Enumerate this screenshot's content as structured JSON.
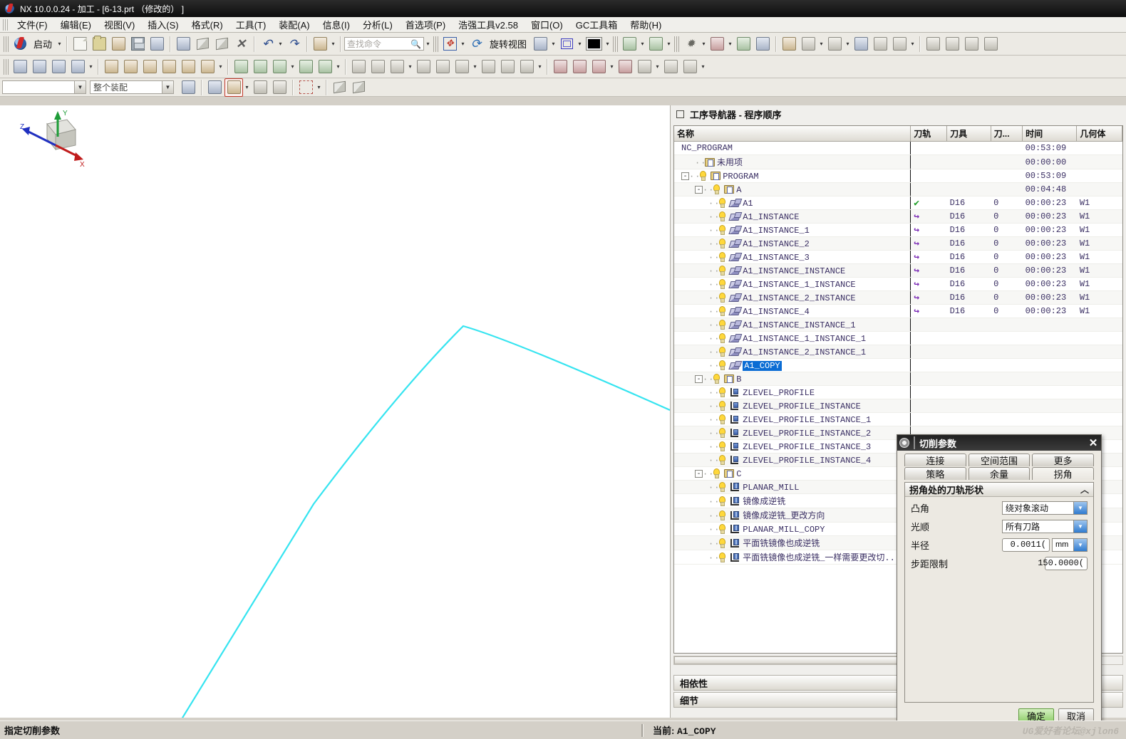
{
  "window": {
    "title": "NX 10.0.0.24 - 加工 - [6-13.prt  （修改的）  ]",
    "app_icon": "nx-logo-icon"
  },
  "menubar": {
    "items": [
      {
        "label": "文件(F)"
      },
      {
        "label": "编辑(E)"
      },
      {
        "label": "视图(V)"
      },
      {
        "label": "插入(S)"
      },
      {
        "label": "格式(R)"
      },
      {
        "label": "工具(T)"
      },
      {
        "label": "装配(A)"
      },
      {
        "label": "信息(I)"
      },
      {
        "label": "分析(L)"
      },
      {
        "label": "首选项(P)"
      },
      {
        "label": "浩强工具v2.58"
      },
      {
        "label": "窗口(O)"
      },
      {
        "label": "GC工具箱"
      },
      {
        "label": "帮助(H)"
      }
    ]
  },
  "toolbar": {
    "start_label": "启动",
    "search_placeholder": "查找命令",
    "rotate_view_label": "旋转视图",
    "assembly_scope": "整个装配",
    "assembly_filter_placeholder": ""
  },
  "navigator": {
    "title": "工序导航器 - 程序顺序",
    "columns": [
      "名称",
      "刀轨",
      "刀具",
      "刀...",
      "时间",
      "几何体"
    ],
    "rows": [
      {
        "indent": 0,
        "twist": "",
        "icon": "none",
        "bulb": false,
        "name": "NC_PROGRAM",
        "track": "",
        "tool": "",
        "toolnum": "",
        "time": "00:53:09",
        "geom": ""
      },
      {
        "indent": 1,
        "twist": "",
        "icon": "folder",
        "bulb": false,
        "name": "未用项",
        "track": "",
        "tool": "",
        "toolnum": "",
        "time": "00:00:00",
        "geom": ""
      },
      {
        "indent": 0,
        "twist": "-",
        "icon": "folder",
        "bulb": true,
        "name": "PROGRAM",
        "track": "",
        "tool": "",
        "toolnum": "",
        "time": "00:53:09",
        "geom": ""
      },
      {
        "indent": 1,
        "twist": "-",
        "icon": "folder",
        "bulb": true,
        "name": "A",
        "track": "",
        "tool": "",
        "toolnum": "",
        "time": "00:04:48",
        "geom": ""
      },
      {
        "indent": 2,
        "twist": "",
        "icon": "mill3d",
        "bulb": true,
        "name": "A1",
        "track": "check",
        "tool": "D16",
        "toolnum": "0",
        "time": "00:00:23",
        "geom": "W1"
      },
      {
        "indent": 2,
        "twist": "",
        "icon": "mill3d",
        "bulb": true,
        "name": "A1_INSTANCE",
        "track": "arrow",
        "tool": "D16",
        "toolnum": "0",
        "time": "00:00:23",
        "geom": "W1"
      },
      {
        "indent": 2,
        "twist": "",
        "icon": "mill3d",
        "bulb": true,
        "name": "A1_INSTANCE_1",
        "track": "arrow",
        "tool": "D16",
        "toolnum": "0",
        "time": "00:00:23",
        "geom": "W1"
      },
      {
        "indent": 2,
        "twist": "",
        "icon": "mill3d",
        "bulb": true,
        "name": "A1_INSTANCE_2",
        "track": "arrow",
        "tool": "D16",
        "toolnum": "0",
        "time": "00:00:23",
        "geom": "W1"
      },
      {
        "indent": 2,
        "twist": "",
        "icon": "mill3d",
        "bulb": true,
        "name": "A1_INSTANCE_3",
        "track": "arrow",
        "tool": "D16",
        "toolnum": "0",
        "time": "00:00:23",
        "geom": "W1"
      },
      {
        "indent": 2,
        "twist": "",
        "icon": "mill3d",
        "bulb": true,
        "name": "A1_INSTANCE_INSTANCE",
        "track": "arrow",
        "tool": "D16",
        "toolnum": "0",
        "time": "00:00:23",
        "geom": "W1"
      },
      {
        "indent": 2,
        "twist": "",
        "icon": "mill3d",
        "bulb": true,
        "name": "A1_INSTANCE_1_INSTANCE",
        "track": "arrow",
        "tool": "D16",
        "toolnum": "0",
        "time": "00:00:23",
        "geom": "W1"
      },
      {
        "indent": 2,
        "twist": "",
        "icon": "mill3d",
        "bulb": true,
        "name": "A1_INSTANCE_2_INSTANCE",
        "track": "arrow",
        "tool": "D16",
        "toolnum": "0",
        "time": "00:00:23",
        "geom": "W1"
      },
      {
        "indent": 2,
        "twist": "",
        "icon": "mill3d",
        "bulb": true,
        "name": "A1_INSTANCE_4",
        "track": "arrow",
        "tool": "D16",
        "toolnum": "0",
        "time": "00:00:23",
        "geom": "W1"
      },
      {
        "indent": 2,
        "twist": "",
        "icon": "mill3d",
        "bulb": true,
        "name": "A1_INSTANCE_INSTANCE_1",
        "track": "",
        "tool": "",
        "toolnum": "",
        "time": "",
        "geom": ""
      },
      {
        "indent": 2,
        "twist": "",
        "icon": "mill3d",
        "bulb": true,
        "name": "A1_INSTANCE_1_INSTANCE_1",
        "track": "",
        "tool": "",
        "toolnum": "",
        "time": "",
        "geom": ""
      },
      {
        "indent": 2,
        "twist": "",
        "icon": "mill3d",
        "bulb": true,
        "name": "A1_INSTANCE_2_INSTANCE_1",
        "track": "",
        "tool": "",
        "toolnum": "",
        "time": "",
        "geom": ""
      },
      {
        "indent": 2,
        "twist": "",
        "icon": "mill3d",
        "bulb": true,
        "name": "A1_COPY",
        "track": "",
        "tool": "",
        "toolnum": "",
        "time": "",
        "geom": "",
        "selected": true
      },
      {
        "indent": 1,
        "twist": "-",
        "icon": "folder",
        "bulb": true,
        "name": "B",
        "track": "",
        "tool": "",
        "toolnum": "",
        "time": "",
        "geom": ""
      },
      {
        "indent": 2,
        "twist": "",
        "icon": "zlevel",
        "bulb": true,
        "name": "ZLEVEL_PROFILE",
        "track": "",
        "tool": "",
        "toolnum": "",
        "time": "",
        "geom": ""
      },
      {
        "indent": 2,
        "twist": "",
        "icon": "zlevel",
        "bulb": true,
        "name": "ZLEVEL_PROFILE_INSTANCE",
        "track": "",
        "tool": "",
        "toolnum": "",
        "time": "",
        "geom": ""
      },
      {
        "indent": 2,
        "twist": "",
        "icon": "zlevel",
        "bulb": true,
        "name": "ZLEVEL_PROFILE_INSTANCE_1",
        "track": "",
        "tool": "",
        "toolnum": "",
        "time": "",
        "geom": ""
      },
      {
        "indent": 2,
        "twist": "",
        "icon": "zlevel",
        "bulb": true,
        "name": "ZLEVEL_PROFILE_INSTANCE_2",
        "track": "",
        "tool": "",
        "toolnum": "",
        "time": "",
        "geom": ""
      },
      {
        "indent": 2,
        "twist": "",
        "icon": "zlevel",
        "bulb": true,
        "name": "ZLEVEL_PROFILE_INSTANCE_3",
        "track": "",
        "tool": "",
        "toolnum": "",
        "time": "",
        "geom": ""
      },
      {
        "indent": 2,
        "twist": "",
        "icon": "zlevel",
        "bulb": true,
        "name": "ZLEVEL_PROFILE_INSTANCE_4",
        "track": "",
        "tool": "",
        "toolnum": "",
        "time": "",
        "geom": ""
      },
      {
        "indent": 1,
        "twist": "-",
        "icon": "folder",
        "bulb": true,
        "name": "C",
        "track": "",
        "tool": "",
        "toolnum": "",
        "time": "",
        "geom": ""
      },
      {
        "indent": 2,
        "twist": "",
        "icon": "planar",
        "bulb": true,
        "name": "PLANAR_MILL",
        "track": "",
        "tool": "",
        "toolnum": "",
        "time": "",
        "geom": ""
      },
      {
        "indent": 2,
        "twist": "",
        "icon": "planar",
        "bulb": true,
        "name": "镜像成逆铣",
        "track": "",
        "tool": "",
        "toolnum": "",
        "time": "",
        "geom": ""
      },
      {
        "indent": 2,
        "twist": "",
        "icon": "planar",
        "bulb": true,
        "name": "镜像成逆铣_更改方向",
        "track": "",
        "tool": "",
        "toolnum": "",
        "time": "",
        "geom": ""
      },
      {
        "indent": 2,
        "twist": "",
        "icon": "planar",
        "bulb": true,
        "name": "PLANAR_MILL_COPY",
        "track": "",
        "tool": "",
        "toolnum": "",
        "time": "",
        "geom": ""
      },
      {
        "indent": 2,
        "twist": "",
        "icon": "planar",
        "bulb": true,
        "name": "平面铣镜像也成逆铣",
        "track": "",
        "tool": "",
        "toolnum": "",
        "time": "",
        "geom": ""
      },
      {
        "indent": 2,
        "twist": "",
        "icon": "planar",
        "bulb": true,
        "name": "平面铣镜像也成逆铣_一样需要更改切...",
        "track": "",
        "tool": "",
        "toolnum": "",
        "time": "",
        "geom": ""
      }
    ],
    "sections": [
      {
        "label": "相依性"
      },
      {
        "label": "细节"
      }
    ]
  },
  "dialog": {
    "title": "切削参数",
    "close_label": "✕",
    "tabs_row1": [
      {
        "label": "连接",
        "active": false
      },
      {
        "label": "空间范围",
        "active": false
      },
      {
        "label": "更多",
        "active": false
      }
    ],
    "tabs_row2": [
      {
        "label": "策略",
        "active": false
      },
      {
        "label": "余量",
        "active": false
      },
      {
        "label": "拐角",
        "active": true
      }
    ],
    "group_title": "拐角处的刀轨形状",
    "fields": [
      {
        "label": "凸角",
        "type": "combo",
        "value": "绕对象滚动"
      },
      {
        "label": "光顺",
        "type": "combo",
        "value": "所有刀路"
      },
      {
        "label": "半径",
        "type": "text-unit",
        "value": "0.0011(",
        "unit": "mm"
      },
      {
        "label": "步距限制",
        "type": "text",
        "value": "150.0000("
      }
    ],
    "buttons": {
      "ok": "确定",
      "cancel": "取消"
    }
  },
  "statusbar": {
    "hint": "指定切削参数",
    "current_label": "当前:",
    "current_value": "A1_COPY",
    "watermark": "UG爱好者论坛@xjlon6"
  },
  "viewport": {
    "triad": {
      "x": "X",
      "y": "Y",
      "z": "Z"
    },
    "curve_color": "#36e4f0"
  }
}
